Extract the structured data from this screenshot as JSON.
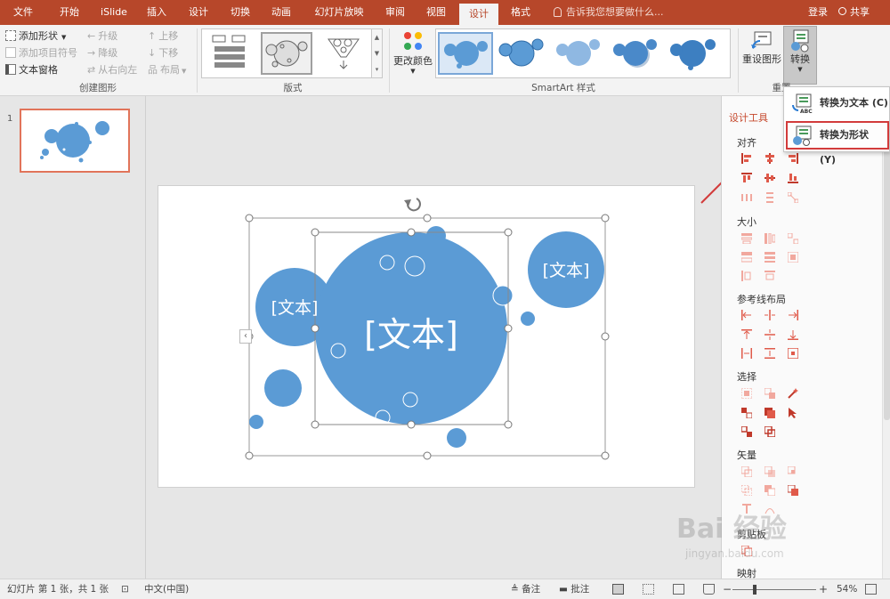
{
  "tabs": [
    {
      "label": "文件",
      "active": false
    },
    {
      "label": "开始",
      "active": false
    },
    {
      "label": "iSlide",
      "active": false
    },
    {
      "label": "插入",
      "active": false
    },
    {
      "label": "设计",
      "active": false
    },
    {
      "label": "切换",
      "active": false
    },
    {
      "label": "动画",
      "active": false
    },
    {
      "label": "幻灯片放映",
      "active": false
    },
    {
      "label": "审阅",
      "active": false
    },
    {
      "label": "视图",
      "active": false
    },
    {
      "label": "设计",
      "active": true
    },
    {
      "label": "格式",
      "active": false
    }
  ],
  "tell_me": "告诉我您想要做什么...",
  "login": "登录",
  "share": "共享",
  "ribbon": {
    "create": {
      "add_shape": "添加形状",
      "add_bullet": "添加项目符号",
      "text_pane": "文本窗格",
      "promote": "升级",
      "demote": "降级",
      "rtl": "从右向左",
      "move_up": "上移",
      "move_down": "下移",
      "layout": "布局",
      "label": "创建图形"
    },
    "layouts_label": "版式",
    "change_colors": "更改颜色",
    "styles_label": "SmartArt 样式",
    "reset_graphic": "重设图形",
    "convert": "转换",
    "reset_label": "重置"
  },
  "dropdown": {
    "to_text": "转换为文本 (C)",
    "to_shapes": "转换为形状 (Y)"
  },
  "slide": {
    "number": "1",
    "text_main": "[文本]",
    "text_left": "[文本]",
    "text_right": "[文本]"
  },
  "tool_pane": {
    "title": "设计工具",
    "sections": [
      "对齐",
      "大小",
      "参考线布局",
      "选择",
      "矢量",
      "剪贴板",
      "映射"
    ]
  },
  "status": {
    "slide_info": "幻灯片 第 1 张，共 1 张",
    "language": "中文(中国)",
    "notes": "备注",
    "comments": "批注",
    "zoom": "54%"
  },
  "watermark": {
    "brand": "Bai 经验",
    "url": "jingyan.baidu.com"
  },
  "colors": {
    "accent": "#b7472a",
    "bubble": "#5b9bd5",
    "highlight": "#d23b3b"
  }
}
